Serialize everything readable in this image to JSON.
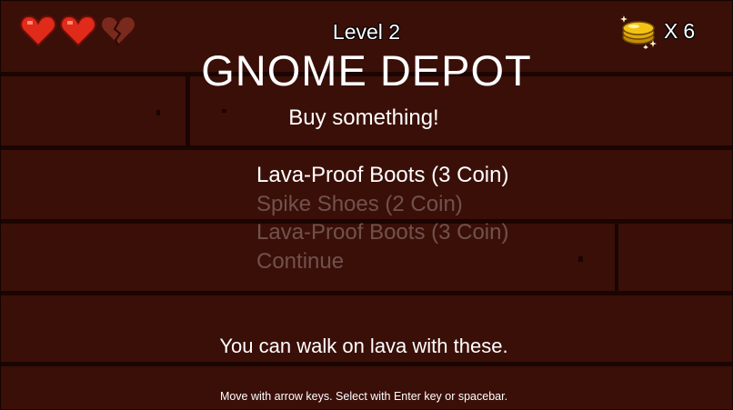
{
  "hud": {
    "hearts": [
      {
        "state": "full",
        "icon": "heart-icon"
      },
      {
        "state": "full",
        "icon": "heart-icon"
      },
      {
        "state": "broken",
        "icon": "broken-heart-icon"
      }
    ],
    "level_label": "Level 2",
    "coins": {
      "prefix": "X",
      "count": "6",
      "icon": "coin-stack-icon"
    }
  },
  "shop": {
    "title": "GNOME DEPOT",
    "subtitle": "Buy something!",
    "options": [
      {
        "label": "Lava-Proof Boots (3 Coin)",
        "selected": true
      },
      {
        "label": "Spike Shoes (2 Coin)",
        "selected": false
      },
      {
        "label": "Lava-Proof Boots (3 Coin)",
        "selected": false
      },
      {
        "label": "Continue",
        "selected": false
      }
    ],
    "description": "You can walk on lava with these."
  },
  "instructions": "Move with arrow keys. Select with Enter key or spacebar.",
  "colors": {
    "wall": "#3a0f08",
    "mortar": "#1a0502",
    "heart_red": "#e02a1a",
    "heart_broken": "#7a2a1c",
    "coin_gold": "#f2c314",
    "selected_text": "#ffffff",
    "dim_text": "rgba(255,255,255,0.28)"
  }
}
